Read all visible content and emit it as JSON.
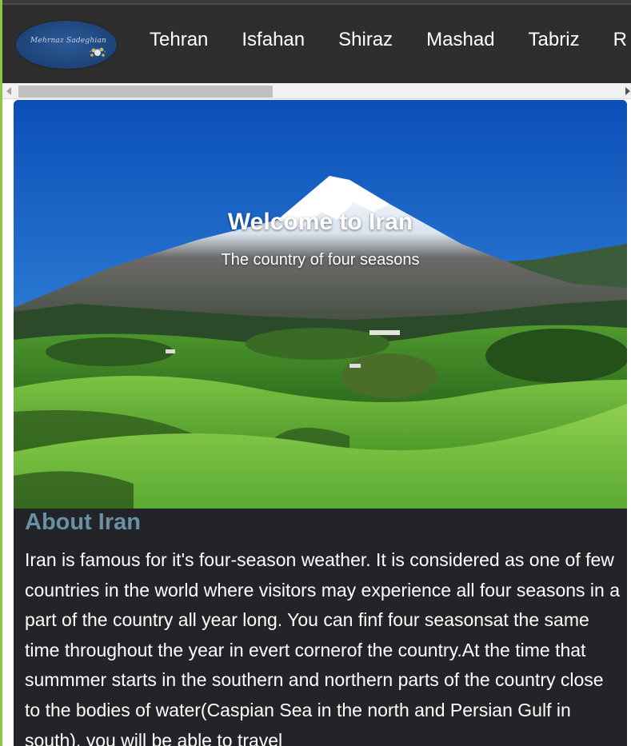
{
  "brand": {
    "logo_text": "Mehrnaz Sadeghian"
  },
  "nav": {
    "items": [
      "Tehran",
      "Isfahan",
      "Shiraz",
      "Mashad",
      "Tabriz",
      "R"
    ]
  },
  "hero": {
    "title": "Welcome to Iran",
    "subtitle": "The country of four seasons"
  },
  "about": {
    "heading": "About Iran",
    "body": "Iran is famous for it's four-season weather. It is considered as one of few countries in the world where visitors may experience all four seasons in a part of the country all year long. You can finf four seasonsat the same time throughout the year in evert cornerof the country.At the time that summmer starts in the southern and northern parts of the country close to the bodies of water(Caspian Sea in the north and Persian Gulf in south), you will be able to travel"
  },
  "colors": {
    "accent_green": "#8dc63f",
    "topbar": "#2e2e2e",
    "card_bg": "#222428",
    "heading_blue": "#6a8fa6"
  }
}
